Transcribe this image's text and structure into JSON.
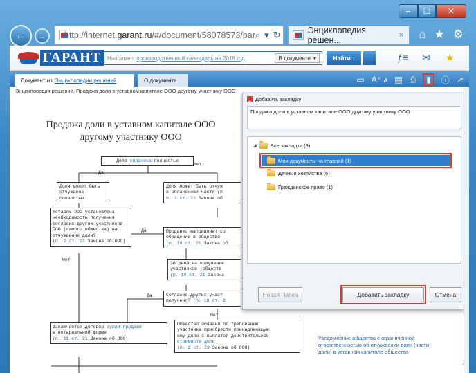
{
  "browser": {
    "url_prefix": "http://internet.",
    "url_domain": "garant.ru",
    "url_rest": "/#/document/58078573/par",
    "tab_title": "Энциклопедия решен...",
    "tab_close": "×"
  },
  "garant": {
    "logo_text": "ГАРАНТ",
    "search_placeholder_prefix": "Например, ",
    "search_placeholder_link": "производственный календарь на 2018 год",
    "search_scope": "В документе",
    "find_label": "Найти"
  },
  "doc_tabs": {
    "active_prefix": "Документ из",
    "active_link": "Энциклопедии решений",
    "inactive": "О документе"
  },
  "breadcrumb": "Энциклопедия решений. Продажа доли в уставном капитале ООО другому участнику ООО",
  "document": {
    "title": "Продажа доли в уставном капитале ООО другому участнику ООО",
    "flow": {
      "start": "Доля оплачена полностью",
      "start_link": "оплачена",
      "yes1": "Да",
      "no1": "Нет",
      "box_yes": "Доля может быть отчуждена полностью",
      "box_no_l1": "Доля может быть отчуж",
      "box_no_l2": "в оплаченной части (п",
      "box_no_link": "п. 3 ст. 21",
      "box_no_law": "Закона об",
      "charter_l1": "Уставом ООО установлена",
      "charter_l2": "необходимость получения",
      "charter_l3": "согласия других участников",
      "charter_l4": "ООО (самого общества) на",
      "charter_l5": "отчуждение доли?",
      "charter_link": "(п. 2 ст. 21",
      "charter_law": "Закона об ООО)",
      "yes2": "Да",
      "no2": "Нет",
      "seller_l1": "Продавец направляет со",
      "seller_l2": "обращение в общество",
      "seller_link": "(п. 10 ст. 21",
      "seller_law": "Закона об",
      "days_l1": "30 дней на получение",
      "days_l2": "участников (обществ",
      "days_link": "(п. 10 ст. 21",
      "days_law": "Закона",
      "consent_l1": "Согласие других участ",
      "consent_l2": "получено?",
      "consent_link": "(п. 10 ст. 2",
      "yes3": "Да",
      "no3": "Нет",
      "contract_l1": "Заключается договор",
      "contract_link1": "купли-продажи",
      "contract_l2": "в нотариальной форме",
      "contract_link2": "(п. 11 ст. 21",
      "contract_law": "Закона об ООО)",
      "obliged_l1": "Общество обязано по требованию",
      "obliged_l2": "участника приобрести принадлежащую",
      "obliged_l3": "ему долю с выплатой действительной",
      "obliged_link": "стоимости доли",
      "obliged_link2": "(п. 2 ст. 23",
      "obliged_law": "Закона об ООО)"
    },
    "side_links": "Уведомление общества с ограниченной ответственностью об отчуждении доли (части доли) в уставном капитале общества"
  },
  "bookmark_popup": {
    "header": "Добавить закладку",
    "name_value": "Продажа доли в уставном капитале ООО другому участнику ООО",
    "tree": {
      "root": "Все закладки (8)",
      "expand": "◢",
      "items": [
        {
          "label": "Мои документы на главной (1)",
          "selected": true
        },
        {
          "label": "Дачные хозяйства (6)",
          "selected": false
        },
        {
          "label": "Гражданское право (1)",
          "selected": false
        }
      ]
    },
    "new_folder": "Новая Папка",
    "add_bookmark": "Добавить закладку",
    "cancel": "Отмена"
  },
  "colors": {
    "accent": "#1d63b3",
    "highlight_red": "#e0392a",
    "selection": "#2f7ed0"
  },
  "icons": [
    "back-icon",
    "forward-icon",
    "search-icon",
    "refresh-icon",
    "home-icon",
    "star-icon",
    "gear-icon",
    "print-icon",
    "bookmark-icon",
    "info-icon"
  ]
}
